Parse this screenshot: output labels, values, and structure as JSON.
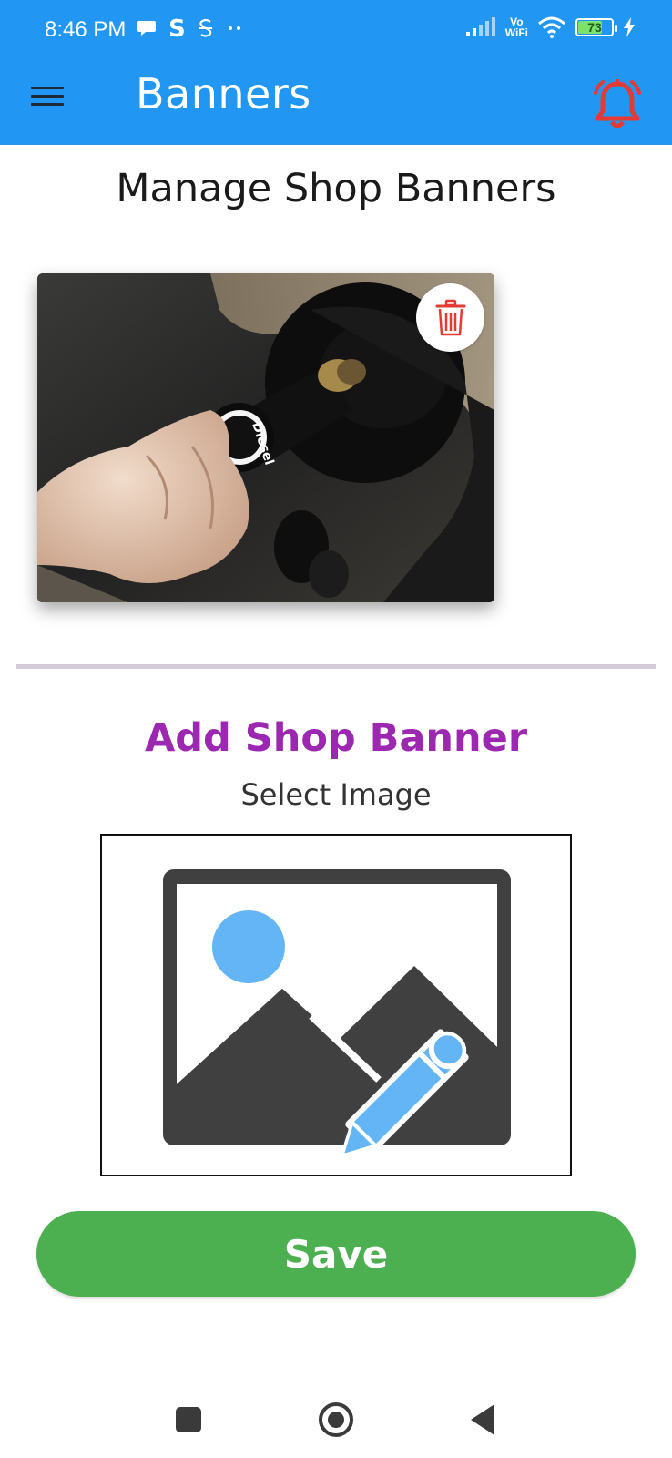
{
  "status_bar": {
    "time": "8:46 PM",
    "vo_line1": "Vo",
    "vo_line2": "WiFi",
    "battery_level": "73",
    "battery_fraction": 0.73
  },
  "app_bar": {
    "title": "Banners",
    "menu_icon": "hamburger-menu-icon",
    "notification_icon": "bell-icon",
    "notification_color": "#e53935"
  },
  "manage": {
    "title": "Manage Shop Banners",
    "banners": [
      {
        "label": "Diesel"
      }
    ]
  },
  "add": {
    "title": "Add Shop Banner",
    "select_label": "Select Image",
    "title_color": "#9c27b0"
  },
  "actions": {
    "save_label": "Save",
    "save_color": "#4caf50"
  },
  "colors": {
    "primary": "#2196f3",
    "delete_icon": "#e53935"
  }
}
